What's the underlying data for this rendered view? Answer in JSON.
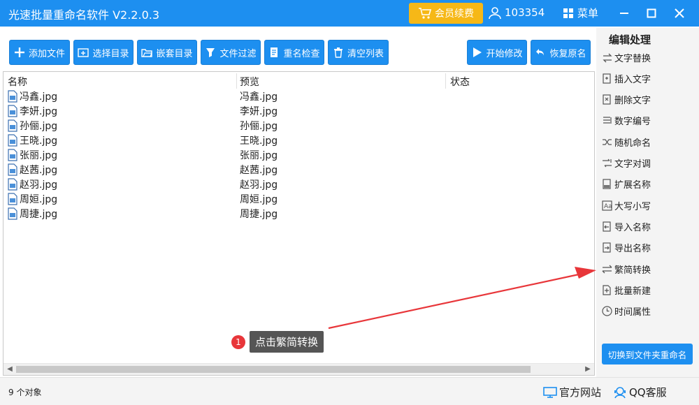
{
  "window": {
    "title": "光速批量重命名软件 V2.2.0.3",
    "vip_label": "会员续费",
    "user_id": "103354",
    "menu_label": "菜单"
  },
  "toolbar": {
    "add_file": "添加文件",
    "select_dir": "选择目录",
    "nested_dir": "嵌套目录",
    "file_filter": "文件过滤",
    "rename_check": "重名检查",
    "clear_list": "清空列表",
    "start_modify": "开始修改",
    "restore_name": "恢复原名"
  },
  "list": {
    "headers": {
      "name": "名称",
      "preview": "预览",
      "status": "状态"
    },
    "rows": [
      {
        "name": "冯鑫.jpg",
        "preview": "冯鑫.jpg"
      },
      {
        "name": "李妍.jpg",
        "preview": "李妍.jpg"
      },
      {
        "name": "孙俪.jpg",
        "preview": "孙俪.jpg"
      },
      {
        "name": "王晓.jpg",
        "preview": "王晓.jpg"
      },
      {
        "name": "张丽.jpg",
        "preview": "张丽.jpg"
      },
      {
        "name": "赵茜.jpg",
        "preview": "赵茜.jpg"
      },
      {
        "name": "赵羽.jpg",
        "preview": "赵羽.jpg"
      },
      {
        "name": "周姮.jpg",
        "preview": "周姮.jpg"
      },
      {
        "name": "周捷.jpg",
        "preview": "周捷.jpg"
      }
    ]
  },
  "panel": {
    "title": "编辑处理",
    "items": [
      {
        "label": "文字替换",
        "icon": "swap-icon"
      },
      {
        "label": "插入文字",
        "icon": "insert-icon"
      },
      {
        "label": "删除文字",
        "icon": "delete-text-icon"
      },
      {
        "label": "数字编号",
        "icon": "numbering-icon"
      },
      {
        "label": "随机命名",
        "icon": "shuffle-icon"
      },
      {
        "label": "文字对调",
        "icon": "exchange-icon"
      },
      {
        "label": "扩展名称",
        "icon": "extension-icon"
      },
      {
        "label": "大写小写",
        "icon": "case-icon"
      },
      {
        "label": "导入名称",
        "icon": "import-icon"
      },
      {
        "label": "导出名称",
        "icon": "export-icon"
      },
      {
        "label": "繁简转换",
        "icon": "convert-icon"
      },
      {
        "label": "批量新建",
        "icon": "new-file-icon"
      },
      {
        "label": "时间属性",
        "icon": "clock-icon"
      }
    ],
    "switch_button": "切换到文件夹重命名"
  },
  "status": {
    "count": "9 个对象",
    "website": "官方网站",
    "qq": "QQ客服"
  },
  "annotation": {
    "number": "1",
    "text": "点击繁简转换"
  },
  "colors": {
    "accent": "#1d8ff0",
    "vip": "#f6b817",
    "annotation_red": "#e8363a"
  }
}
